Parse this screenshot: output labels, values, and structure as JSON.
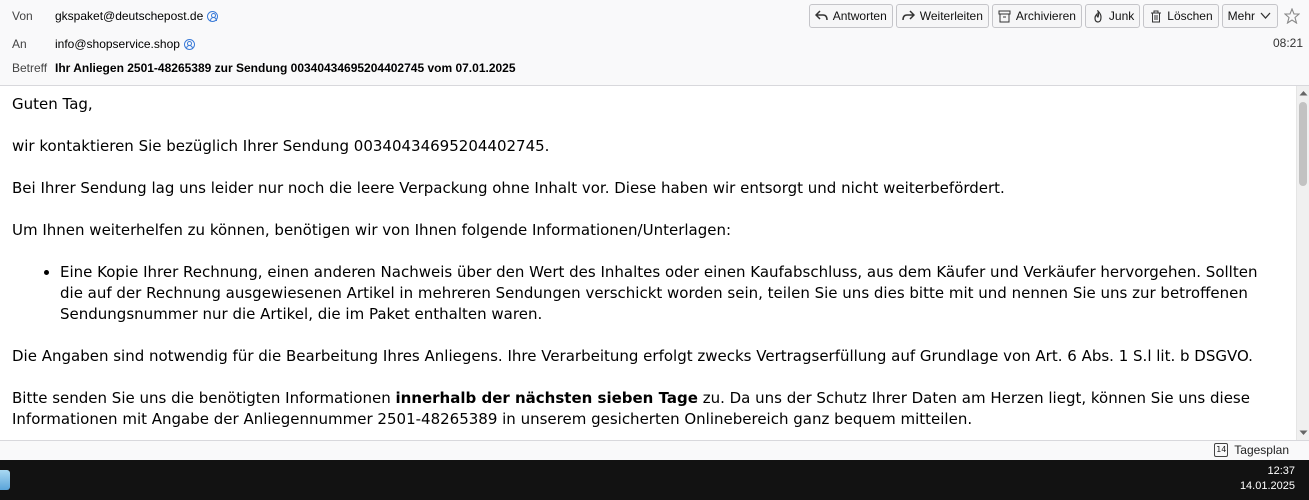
{
  "header": {
    "from_label": "Von",
    "from_value": "gkspaket@deutschepost.de",
    "to_label": "An",
    "to_value": "info@shopservice.shop",
    "subject_label": "Betreff",
    "subject_value": "Ihr Anliegen 2501-48265389 zur Sendung 00340434695204402745 vom 07.01.2025",
    "time": "08:21"
  },
  "toolbar": {
    "reply": "Antworten",
    "forward": "Weiterleiten",
    "archive": "Archivieren",
    "junk": "Junk",
    "delete": "Löschen",
    "more": "Mehr"
  },
  "body": {
    "greeting": "Guten Tag,",
    "p1": "wir kontaktieren Sie bezüglich Ihrer Sendung 00340434695204402745.",
    "p2": "Bei Ihrer Sendung lag uns leider nur noch die leere Verpackung ohne Inhalt vor. Diese haben wir entsorgt und nicht weiterbefördert.",
    "p3": "Um Ihnen weiterhelfen zu können, benötigen wir von Ihnen folgende Informationen/Unterlagen:",
    "bullet1": "Eine Kopie Ihrer Rechnung, einen anderen Nachweis über den Wert des Inhaltes oder einen Kaufabschluss, aus dem Käufer und Verkäufer hervorgehen. Sollten die auf der Rechnung ausgewiesenen Artikel in mehreren Sendungen verschickt worden sein, teilen Sie uns dies bitte mit und nennen Sie uns zur betroffenen Sendungsnummer nur die Artikel, die im Paket enthalten waren.",
    "p4": "Die Angaben sind notwendig für die Bearbeitung Ihres Anliegens. Ihre Verarbeitung erfolgt zwecks Vertragserfüllung auf Grundlage von Art. 6 Abs. 1 S.l lit. b DSGVO.",
    "p5_before": "Bitte senden Sie uns die benötigten Informationen ",
    "p5_bold": "innerhalb der nächsten sieben Tage",
    "p5_after": " zu. Da uns der Schutz Ihrer Daten am Herzen liegt, können Sie uns diese Informationen mit Angabe der Anliegennummer 2501-48265389 in unserem gesicherten Onlinebereich ganz bequem mitteilen."
  },
  "statusbar": {
    "tagesplan": "Tagesplan",
    "calendar_day": "14"
  },
  "taskbar": {
    "clock_time": "12:37",
    "clock_date": "14.01.2025"
  },
  "icons": {
    "reply": "reply-arrow-icon",
    "forward": "forward-arrow-icon",
    "archive": "archive-box-icon",
    "junk": "flame-icon",
    "delete": "trash-icon",
    "more": "chevron-down-icon",
    "star": "star-icon",
    "contact": "contact-person-icon",
    "calendar": "calendar-icon"
  },
  "colors": {
    "contact_icon": "#3b7bd8",
    "taskbar": "#121212"
  }
}
